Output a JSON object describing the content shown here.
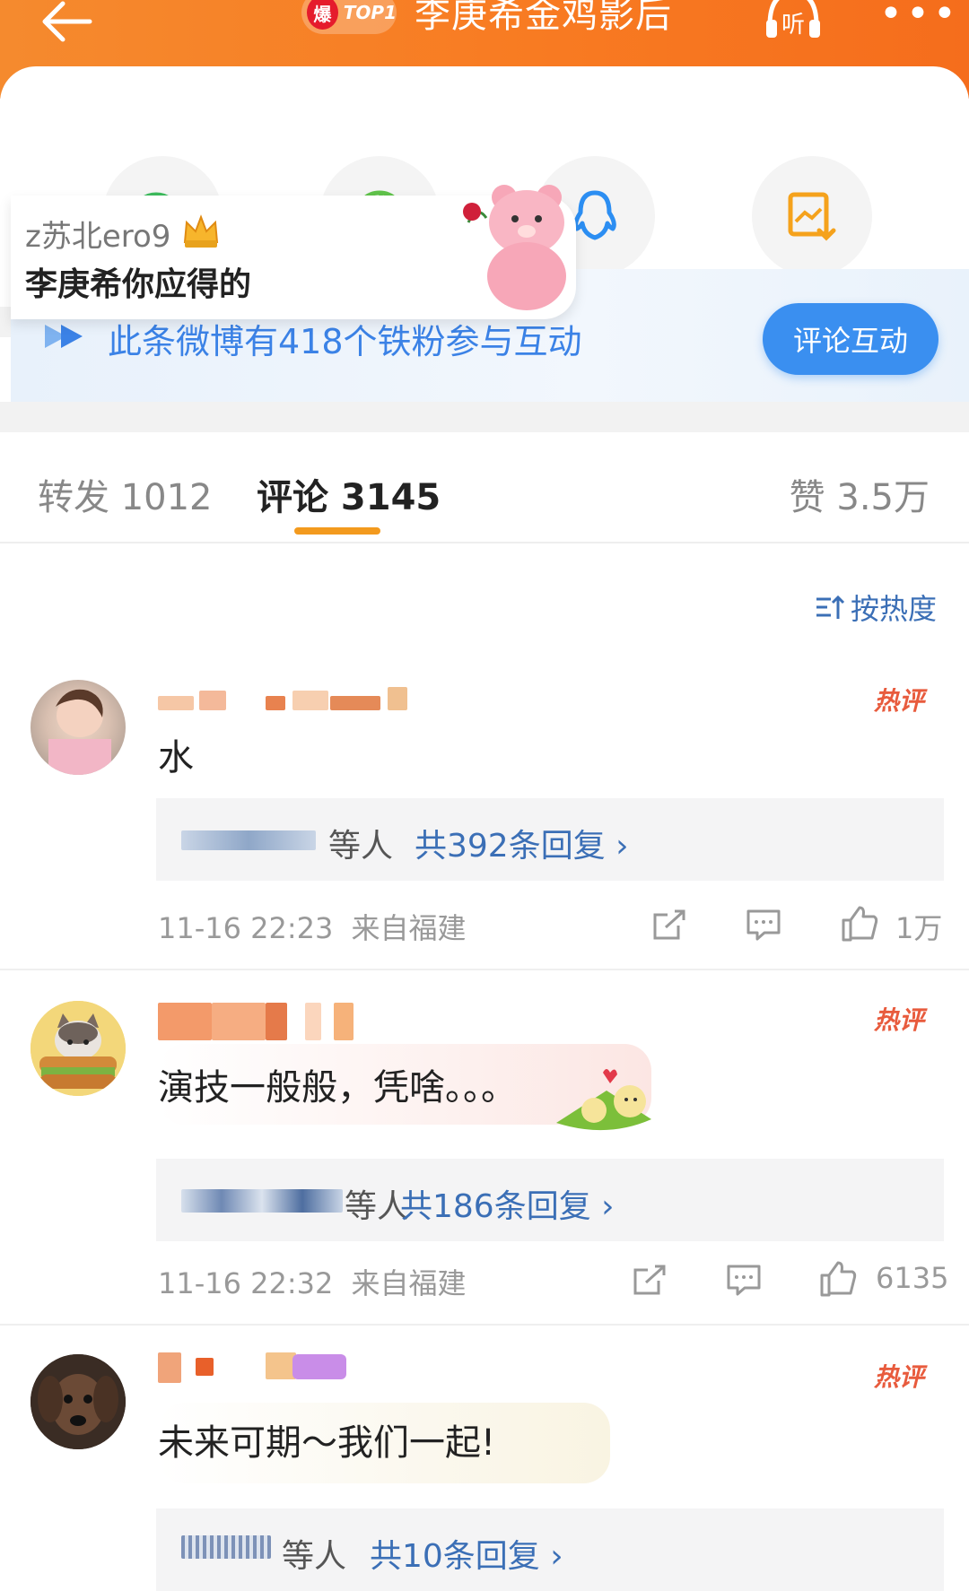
{
  "header": {
    "badge_hot": "爆",
    "badge_rank": "TOP1",
    "title": "李庚希金鸡影后",
    "listen_label": "听",
    "more_label": "•••"
  },
  "share": {
    "items": [
      {
        "name": "wechat-icon",
        "color": "#3cba5c"
      },
      {
        "name": "moments-icon",
        "color": "#5fc24a"
      },
      {
        "name": "qq-icon",
        "color": "#2c8ef2"
      },
      {
        "name": "save-image-icon",
        "color": "#f5a21c"
      }
    ]
  },
  "popup": {
    "username": "z苏北ero9",
    "message": "李庚希你应得的"
  },
  "fans_banner": {
    "text": "此条微博有418个铁粉参与互动",
    "button": "评论互动"
  },
  "tabs": {
    "repost": "转发 1012",
    "comment": "评论 3145",
    "like": "赞 3.5万"
  },
  "sort": {
    "label": "按热度"
  },
  "comments": [
    {
      "hot_label": "热评",
      "text": "水",
      "reply_who": "等人",
      "reply_count": "共392条回复 ›",
      "time": "11-16 22:23",
      "location": "来自福建",
      "likes": "1万"
    },
    {
      "hot_label": "热评",
      "text": "演技一般般，凭啥。。。",
      "reply_who": "等人",
      "reply_count": "共186条回复 ›",
      "time": "11-16 22:32",
      "location": "来自福建",
      "likes": "6135"
    },
    {
      "hot_label": "热评",
      "text": "未来可期～我们一起!",
      "reply_who": "等人",
      "reply_count": "共10条回复 ›"
    }
  ],
  "colors": {
    "brand_orange": "#f87b22",
    "link_blue": "#3b6fb6",
    "hot_red": "#e85b3d"
  }
}
